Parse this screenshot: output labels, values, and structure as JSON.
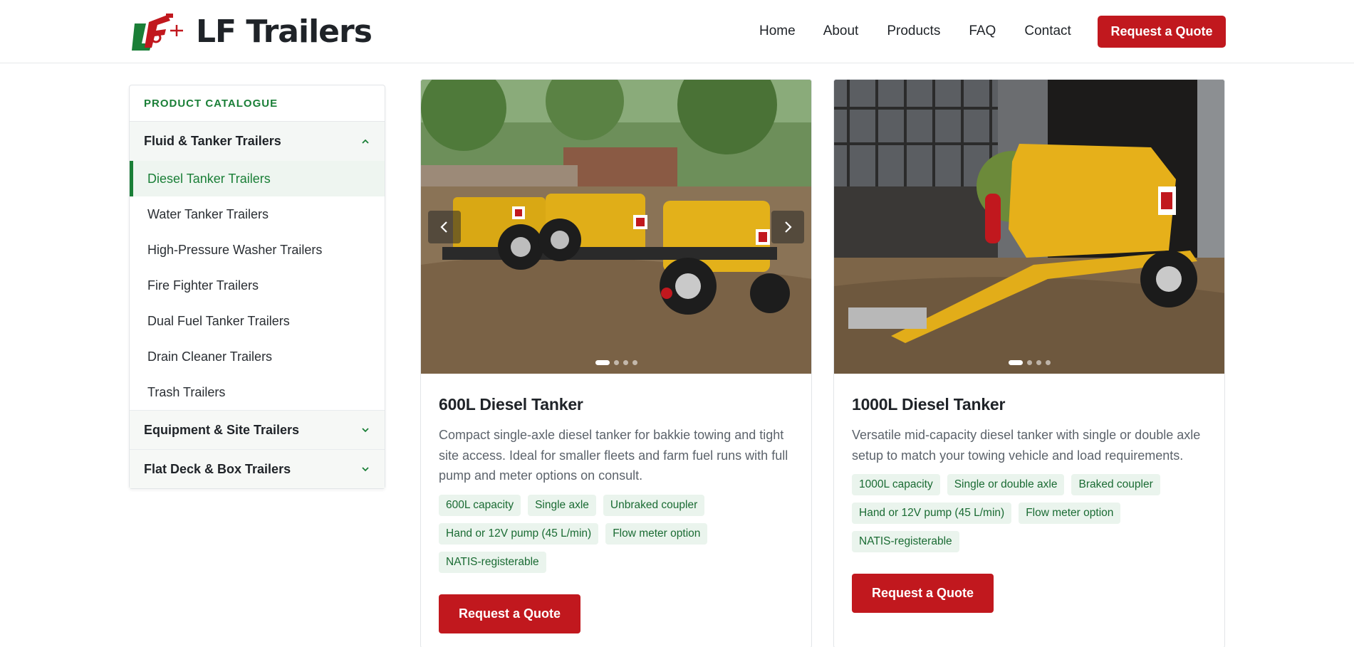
{
  "brand": {
    "name": "LF Trailers",
    "accent": "#c1181e",
    "green": "#1a7f37"
  },
  "nav": {
    "links": [
      "Home",
      "About",
      "Products",
      "FAQ",
      "Contact"
    ],
    "cta": "Request a Quote"
  },
  "sidebar": {
    "title": "PRODUCT CATALOGUE",
    "categories": [
      {
        "label": "Fluid & Tanker Trailers",
        "expanded": true,
        "items": [
          "Diesel Tanker Trailers",
          "Water Tanker Trailers",
          "High-Pressure Washer Trailers",
          "Fire Fighter Trailers",
          "Dual Fuel Tanker Trailers",
          "Drain Cleaner Trailers",
          "Trash Trailers"
        ],
        "active_item": "Diesel Tanker Trailers"
      },
      {
        "label": "Equipment & Site Trailers",
        "expanded": false
      },
      {
        "label": "Flat Deck & Box Trailers",
        "expanded": false
      }
    ]
  },
  "products": [
    {
      "title": "600L Diesel Tanker",
      "description": "Compact single-axle diesel tanker for bakkie towing and tight site access. Ideal for smaller fleets and farm fuel runs with full pump and meter options on consult.",
      "tags": [
        "600L capacity",
        "Single axle",
        "Unbraked coupler",
        "Hand or 12V pump (45 L/min)",
        "Flow meter option",
        "NATIS-registerable"
      ],
      "button": "Request a Quote",
      "image_icon": "yellow-diesel-tanker-trailers-photo"
    },
    {
      "title": "1000L Diesel Tanker",
      "description": "Versatile mid-capacity diesel tanker with single or double axle setup to match your towing vehicle and load requirements.",
      "tags": [
        "1000L capacity",
        "Single or double axle",
        "Braked coupler",
        "Hand or 12V pump (45 L/min)",
        "Flow meter option",
        "NATIS-registerable"
      ],
      "button": "Request a Quote",
      "image_icon": "yellow-diesel-tanker-trailer-photo"
    }
  ]
}
